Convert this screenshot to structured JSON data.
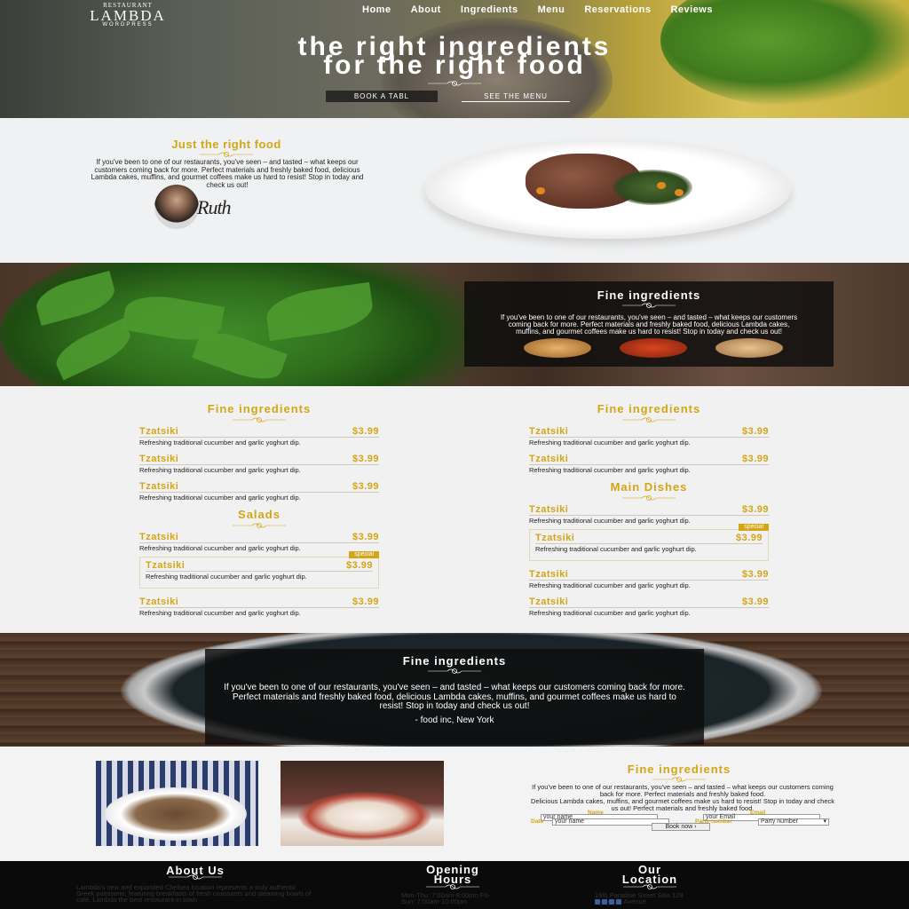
{
  "header": {
    "logo_top": "RESTAURANT",
    "logo_name": "LAMBDA",
    "logo_sub": "WORDPRESS",
    "nav": [
      "Home",
      "About",
      "Ingredients",
      "Menu",
      "Reservations",
      "Reviews"
    ],
    "headline_1": "the right ingredients",
    "headline_2": "for the right food",
    "book_button": "BOOK A TABL",
    "menu_button": "SEE THE MENU"
  },
  "about": {
    "title": "Just the right food",
    "text": "If you've been to one of our restaurants, you've seen – and tasted – what keeps our customers coming back for more. Perfect materials and freshly baked food, delicious Lambda cakes, muffins, and gourmet coffees make us hard to resist! Stop in today and check us out!",
    "signature": "Ruth"
  },
  "ingredients_band": {
    "title": "Fine ingredients",
    "text": "If you've been to one of our restaurants, you've seen – and tasted – what keeps our customers coming back for more. Perfect materials and freshly baked food, delicious Lambda cakes, muffins, and gourmet coffees make us hard to resist! Stop in today and check us out!"
  },
  "menu": {
    "left": {
      "section1_title": "Fine ingredients",
      "section1_items": [
        {
          "name": "Tzatsiki",
          "price": "$3.99",
          "desc": "Refreshing traditional cucumber and garlic yoghurt dip."
        },
        {
          "name": "Tzatsiki",
          "price": "$3.99",
          "desc": "Refreshing traditional cucumber and garlic yoghurt dip."
        },
        {
          "name": "Tzatsiki",
          "price": "$3.99",
          "desc": "Refreshing traditional cucumber and garlic yoghurt dip."
        }
      ],
      "section2_title": "Salads",
      "section2_items": [
        {
          "name": "Tzatsiki",
          "price": "$3.99",
          "desc": "Refreshing traditional cucumber and garlic yoghurt dip."
        },
        {
          "name": "Tzatsiki",
          "price": "$3.99",
          "desc": "Refreshing traditional cucumber and garlic yoghurt dip.",
          "badge": "special"
        },
        {
          "name": "Tzatsiki",
          "price": "$3.99",
          "desc": "Refreshing traditional cucumber and garlic yoghurt dip."
        }
      ]
    },
    "right": {
      "section1_title": "Fine ingredients",
      "section1_items": [
        {
          "name": "Tzatsiki",
          "price": "$3.99",
          "desc": "Refreshing traditional cucumber and garlic yoghurt dip."
        },
        {
          "name": "Tzatsiki",
          "price": "$3.99",
          "desc": "Refreshing traditional cucumber and garlic yoghurt dip."
        }
      ],
      "section2_title": "Main Dishes",
      "section2_items": [
        {
          "name": "Tzatsiki",
          "price": "$3.99",
          "desc": "Refreshing traditional cucumber and garlic yoghurt dip."
        },
        {
          "name": "Tzatsiki",
          "price": "$3.99",
          "desc": "Refreshing traditional cucumber and garlic yoghurt dip.",
          "badge": "special"
        },
        {
          "name": "Tzatsiki",
          "price": "$3.99",
          "desc": "Refreshing traditional cucumber and garlic yoghurt dip."
        },
        {
          "name": "Tzatsiki",
          "price": "$3.99",
          "desc": "Refreshing traditional cucumber and garlic yoghurt dip."
        }
      ]
    }
  },
  "testimonial": {
    "title": "Fine ingredients",
    "text": "If you've been to one of our restaurants, you've seen – and tasted – what keeps our customers coming back for more. Perfect materials and freshly baked food, delicious Lambda cakes, muffins, and gourmet coffees make us hard to resist! Stop in today and check us out!",
    "author": "- food inc, New York"
  },
  "reservation": {
    "title": "Fine ingredients",
    "text1": "If you've been to one of our restaurants, you've seen – and tasted – what keeps our customers coming back for more. Perfect materials and freshly baked food.",
    "text2": "Delicious Lambda cakes, muffins, and gourmet coffees make us hard to resist! Stop in today and check us out! Perfect materials and freshly baked food.",
    "name_label": "Name",
    "email_label": "Email",
    "name_placeholder": "your name",
    "email_placeholder": "your Email",
    "date_label": "Date",
    "date_placeholder": "your name",
    "party_label": "Party number",
    "party_value": "Party number",
    "submit": "Book now"
  },
  "footer": {
    "about_title": "About Us",
    "about_text": "Lambda's new and expanded Chelsea location represents a truly authentic Greek patisserie, featuring breakfasts of fresh croissants and steaming bowls of café. Lambda the best restaurant in town",
    "hours_title_1": "Opening",
    "hours_title_2": "Hours",
    "hours_text": "Mon-Thu: 7:00am-8:00pm Fri-Sun: 7:00am-10:00pm",
    "location_title_1": "Our",
    "location_title_2": "Location",
    "location_text": "19th Paradise Street Sitia 128 Meserole Avenue"
  }
}
